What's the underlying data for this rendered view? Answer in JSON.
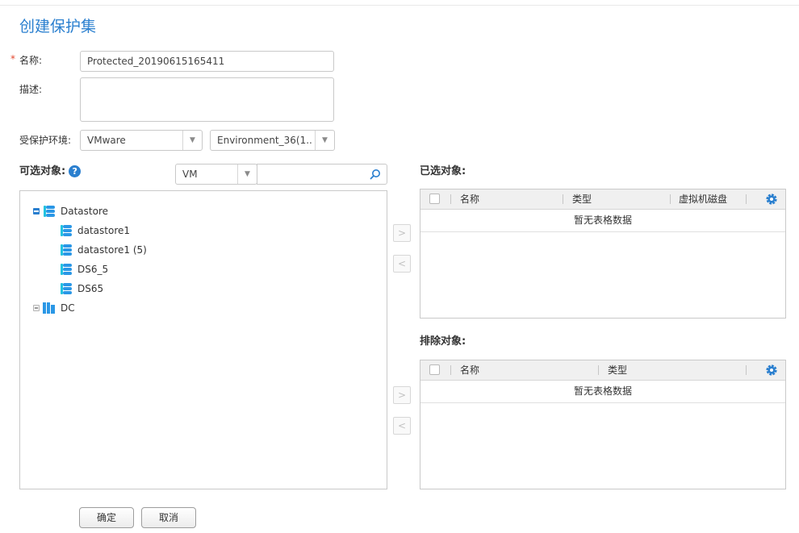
{
  "page": {
    "title": "创建保护集"
  },
  "form": {
    "name": {
      "required_mark": "*",
      "label": "名称:",
      "value": "Protected_20190615165411"
    },
    "description": {
      "label": "描述:",
      "value": ""
    },
    "environment": {
      "label": "受保护环境:",
      "platform_value": "VMware",
      "environment_value": "Environment_36(1..."
    }
  },
  "available": {
    "label": "可选对象:",
    "help_glyph": "?",
    "type_filter_value": "VM",
    "search_value": "",
    "tree": [
      {
        "label": "Datastore",
        "level": 0,
        "expanded": true,
        "icon": "datastore-icon"
      },
      {
        "label": "datastore1",
        "level": 1,
        "icon": "datastore-icon"
      },
      {
        "label": "datastore1 (5)",
        "level": 1,
        "icon": "datastore-icon"
      },
      {
        "label": "DS6_5",
        "level": 1,
        "icon": "datastore-icon"
      },
      {
        "label": "DS65",
        "level": 1,
        "icon": "datastore-icon"
      },
      {
        "label": "DC",
        "level": 0,
        "expanded": false,
        "icon": "datacenter-icon"
      }
    ]
  },
  "transfer": {
    "add_glyph": ">",
    "remove_glyph": "<"
  },
  "selected": {
    "label": "已选对象:",
    "columns": [
      "名称",
      "类型",
      "虚拟机磁盘"
    ],
    "empty_text": "暂无表格数据"
  },
  "excluded": {
    "label": "排除对象:",
    "columns": [
      "名称",
      "类型"
    ],
    "empty_text": "暂无表格数据"
  },
  "actions": {
    "confirm_label": "确定",
    "cancel_label": "取消"
  },
  "colors": {
    "accent": "#2a7fcf",
    "required": "#e3472f",
    "icon_blue": "#2a97e6",
    "icon_cyan": "#22c3e0"
  }
}
